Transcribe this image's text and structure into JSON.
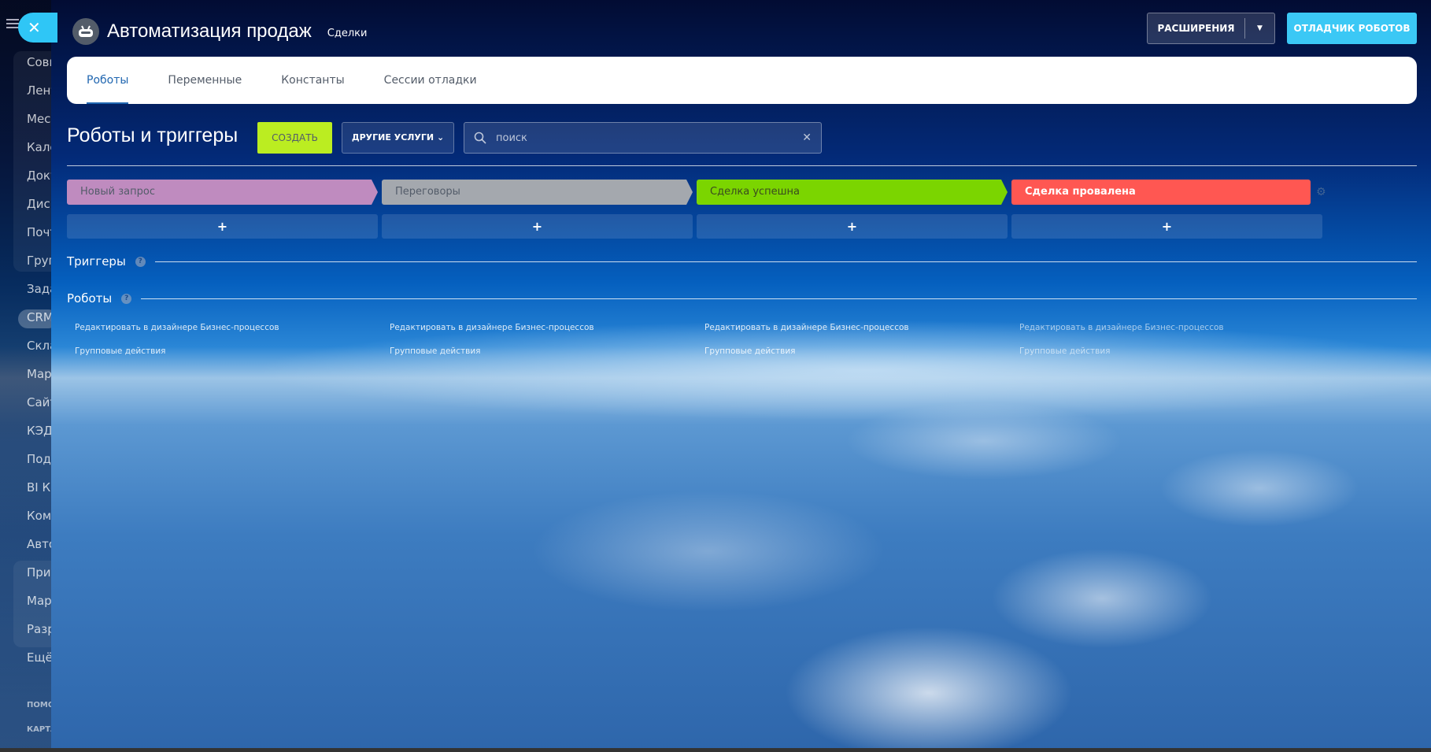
{
  "sidebar": {
    "items": [
      "Совм",
      "Лент",
      "Месс",
      "Кале",
      "Доку",
      "Диск",
      "Почт",
      "Груп",
      "Зада",
      "CRM",
      "Скла",
      "Мар",
      "Сайт",
      "КЭДО",
      "Подп",
      "BI Ко",
      "Комп",
      "Авто",
      "Прил",
      "Мар",
      "Разр",
      "Ещё"
    ],
    "footer": [
      "ПОМО",
      "КАРТА"
    ]
  },
  "header": {
    "title": "Автоматизация продаж",
    "crumb": "Сделки",
    "extensions_label": "РАСШИРЕНИЯ",
    "debugger_label": "ОТЛАДЧИК РОБОТОВ"
  },
  "tabs": [
    "Роботы",
    "Переменные",
    "Константы",
    "Сессии отладки"
  ],
  "toolbar": {
    "title": "Роботы и триггеры",
    "create_label": "СОЗДАТЬ",
    "other_label": "ДРУГИЕ УСЛУГИ",
    "search_placeholder": "поиск"
  },
  "stages": [
    {
      "name": "Новый запрос",
      "color": "#bf8bbf",
      "text": "#535c69"
    },
    {
      "name": "Переговоры",
      "color": "#a4a8ae",
      "text": "#535c69"
    },
    {
      "name": "Сделка успешна",
      "color": "#7bd500",
      "text": "#3a4a20"
    },
    {
      "name": "Сделка провалена",
      "color": "#ff5752",
      "text": "#ffffff"
    }
  ],
  "sections": {
    "triggers": "Триггеры",
    "robots": "Роботы"
  },
  "links": {
    "edit": "Редактировать в дизайнере Бизнес-процессов",
    "group": "Групповые действия"
  }
}
